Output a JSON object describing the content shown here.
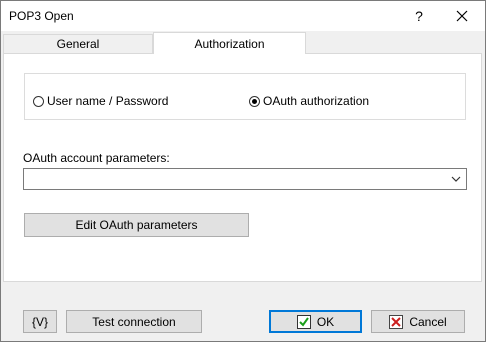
{
  "window": {
    "title": "POP3 Open",
    "help_label": "?"
  },
  "tabs": [
    {
      "label": "General",
      "active": false
    },
    {
      "label": "Authorization",
      "active": true
    }
  ],
  "auth": {
    "options": [
      {
        "label": "User name / Password",
        "checked": false
      },
      {
        "label": "OAuth authorization",
        "checked": true
      }
    ],
    "oauth_params_label": "OAuth account parameters:",
    "oauth_params_value": "",
    "edit_button_label": "Edit OAuth parameters"
  },
  "footer": {
    "variables_label": "{V}",
    "test_label": "Test connection",
    "ok_label": "OK",
    "cancel_label": "Cancel"
  },
  "colors": {
    "accent": "#0078d7",
    "check_green": "#1a9e1a",
    "cancel_red": "#cc1f1f"
  },
  "icons": [
    "close-icon",
    "chevron-down-icon",
    "checkmark-icon",
    "cancel-x-icon"
  ]
}
